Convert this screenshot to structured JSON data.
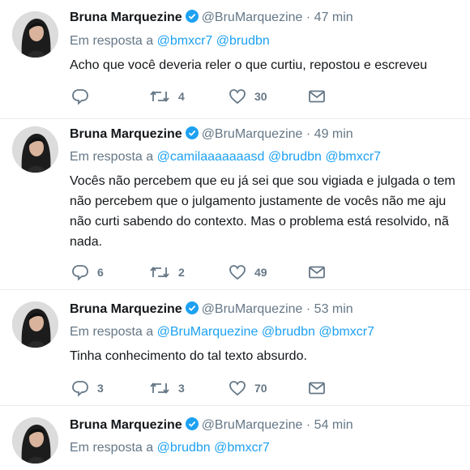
{
  "tweets": [
    {
      "name": "Bruna Marquezine",
      "handle": "@BruMarquezine",
      "separator": "·",
      "time": "47 min",
      "reply_prefix": "Em resposta a",
      "mentions": [
        "@bmxcr7",
        "@brudbn"
      ],
      "lines": [
        "Acho que você deveria reler o que curtiu, repostou e escreveu"
      ],
      "replies": "",
      "retweets": "4",
      "likes": "30"
    },
    {
      "name": "Bruna Marquezine",
      "handle": "@BruMarquezine",
      "separator": "·",
      "time": "49 min",
      "reply_prefix": "Em resposta a",
      "mentions": [
        "@camilaaaaaaasd",
        "@brudbn",
        "@bmxcr7"
      ],
      "lines": [
        "Vocês não percebem que eu já sei que sou vigiada e julgada o tem",
        "não percebem que o julgamento justamente de vocês não me aju",
        "não curti sabendo do contexto. Mas o problema está resolvido, nã",
        "nada."
      ],
      "replies": "6",
      "retweets": "2",
      "likes": "49"
    },
    {
      "name": "Bruna Marquezine",
      "handle": "@BruMarquezine",
      "separator": "·",
      "time": "53 min",
      "reply_prefix": "Em resposta a",
      "mentions": [
        "@BruMarquezine",
        "@brudbn",
        "@bmxcr7"
      ],
      "lines": [
        "Tinha conhecimento do tal texto absurdo."
      ],
      "replies": "3",
      "retweets": "3",
      "likes": "70"
    },
    {
      "name": "Bruna Marquezine",
      "handle": "@BruMarquezine",
      "separator": "·",
      "time": "54 min",
      "reply_prefix": "Em resposta a",
      "mentions": [
        "@brudbn",
        "@bmxcr7"
      ],
      "lines": [],
      "replies": "",
      "retweets": "",
      "likes": ""
    }
  ],
  "icons": {
    "verified": "verified-badge-icon",
    "reply": "reply-icon",
    "retweet": "retweet-icon",
    "like": "heart-icon",
    "dm": "envelope-icon"
  },
  "colors": {
    "link": "#1da1f2",
    "secondary": "#657786",
    "text": "#14171a",
    "divider": "#e6ecf0"
  }
}
